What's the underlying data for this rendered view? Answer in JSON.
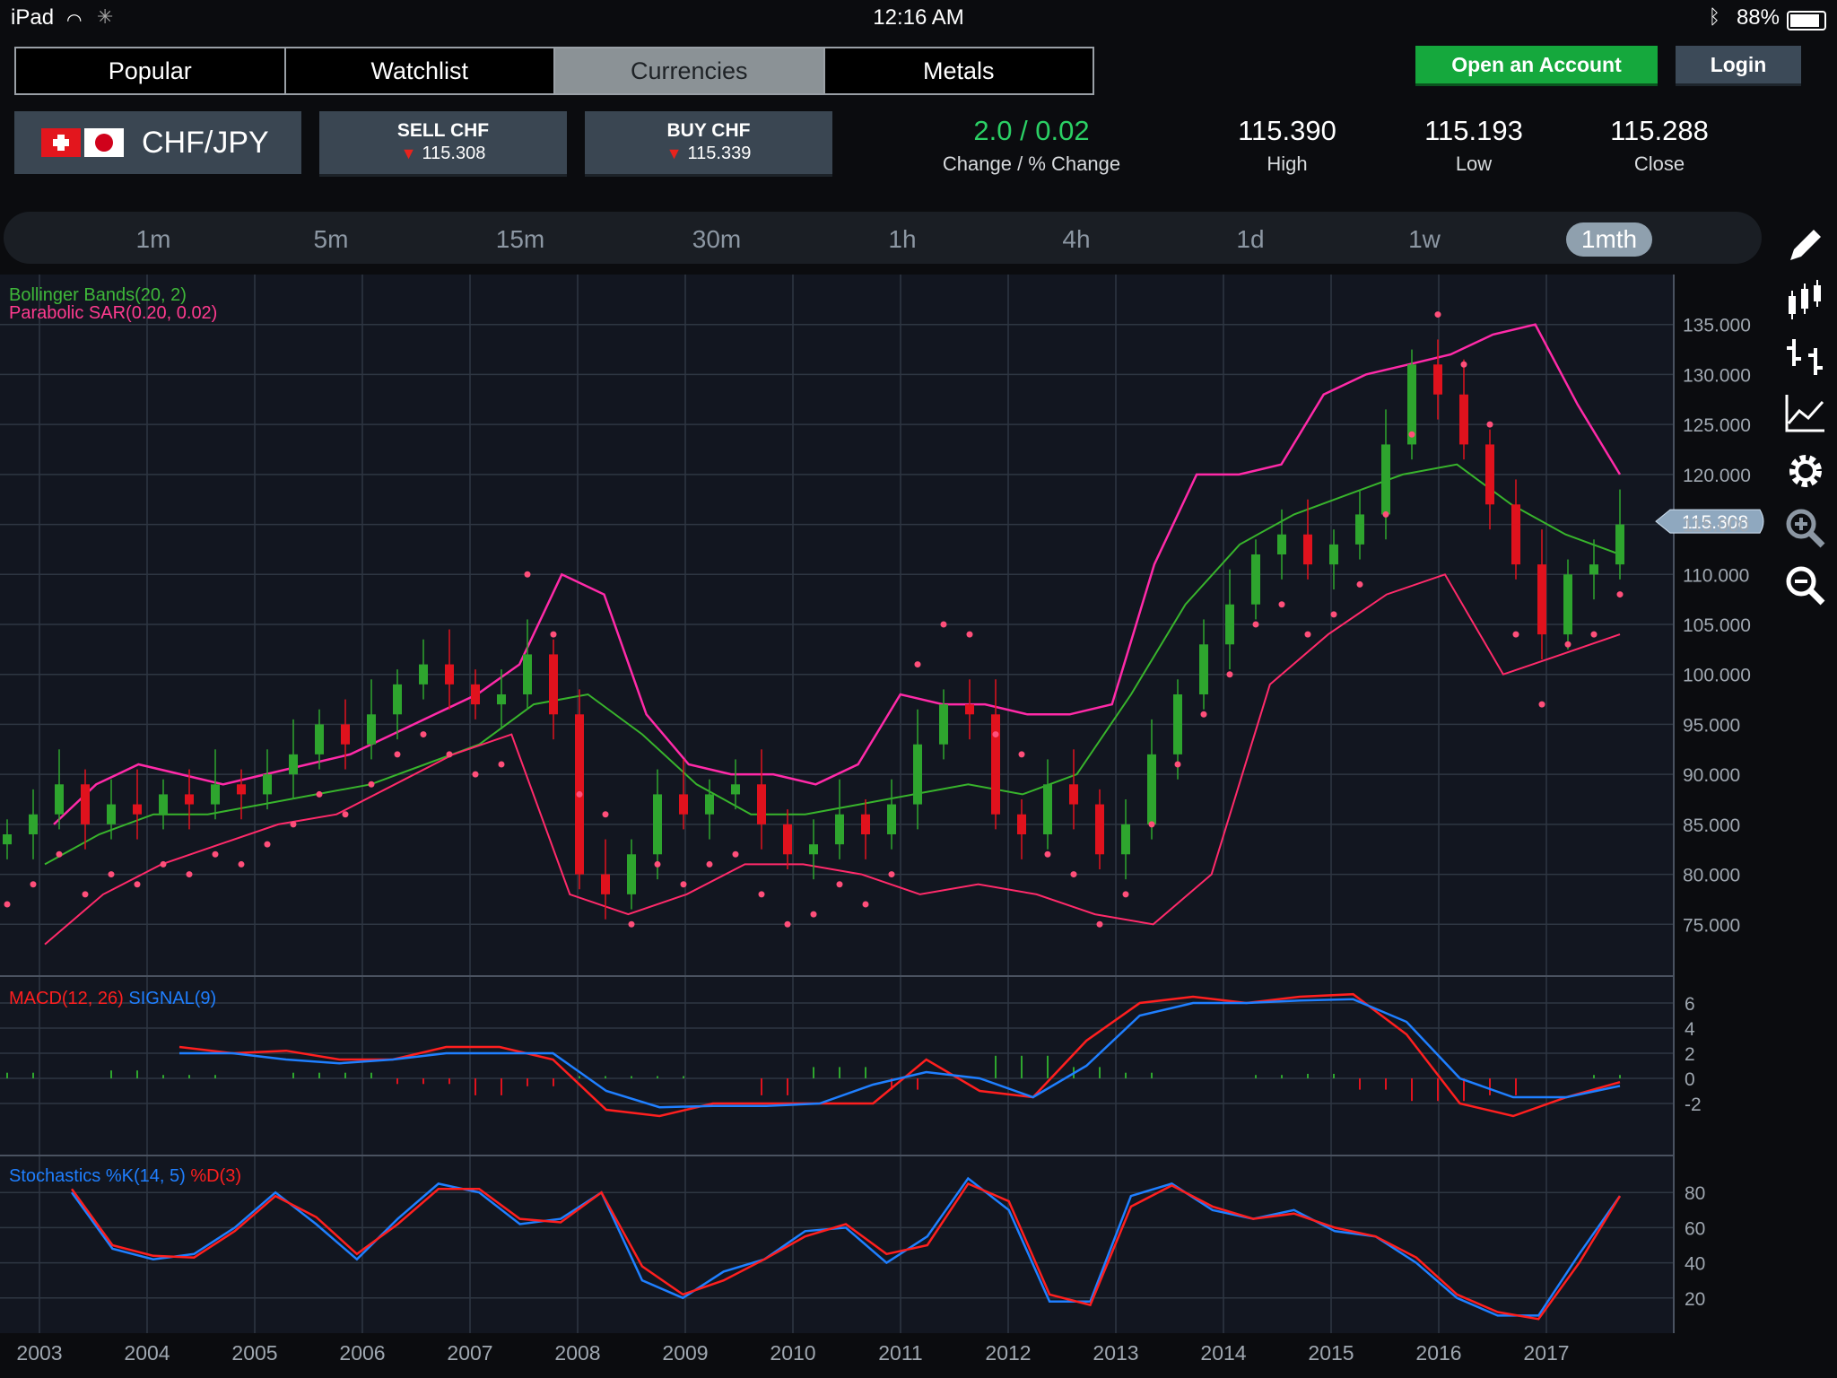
{
  "status_bar": {
    "device": "iPad",
    "time": "12:16 AM",
    "battery": "88%"
  },
  "top_tabs": [
    {
      "label": "Popular",
      "active": false
    },
    {
      "label": "Watchlist",
      "active": false
    },
    {
      "label": "Currencies",
      "active": true
    },
    {
      "label": "Metals",
      "active": false
    }
  ],
  "header_buttons": {
    "open_account": "Open an Account",
    "login": "Login"
  },
  "instrument": {
    "pair": "CHF/JPY",
    "sell": {
      "label": "SELL CHF",
      "price": "115.308"
    },
    "buy": {
      "label": "BUY CHF",
      "price": "115.339"
    },
    "change": {
      "value": "2.0 / 0.02",
      "label": "Change / % Change"
    },
    "high": {
      "value": "115.390",
      "label": "High"
    },
    "low": {
      "value": "115.193",
      "label": "Low"
    },
    "close": {
      "value": "115.288",
      "label": "Close"
    }
  },
  "timeframes": [
    "1m",
    "5m",
    "15m",
    "30m",
    "1h",
    "4h",
    "1d",
    "1w",
    "1mth"
  ],
  "active_timeframe": "1mth",
  "tools": [
    "pencil-icon",
    "candlestick-icon",
    "ohlc-bars-icon",
    "line-chart-icon",
    "settings-gear-icon",
    "zoom-in-icon",
    "zoom-out-icon"
  ],
  "colors": {
    "bull": "#2ea52e",
    "bear": "#e0121d",
    "upper_band": "#ff2aa8",
    "mid_band": "#38b42c",
    "lower_band": "#ff2a6a",
    "sar": "#ff4f7a",
    "macd": "#ff1f1f",
    "signal": "#1f7fff",
    "stoch_k": "#1f7fff",
    "stoch_d": "#ff1f1f"
  },
  "chart_data": {
    "type": "candlestick",
    "current_price_label": "115.308",
    "price_axis": {
      "ticks": [
        "135.000",
        "130.000",
        "125.000",
        "120.000",
        "115.000",
        "110.000",
        "105.000",
        "100.000",
        "95.000",
        "90.000",
        "85.000",
        "80.000",
        "75.000"
      ],
      "range": [
        70,
        140
      ]
    },
    "x_axis": {
      "ticks": [
        "2003",
        "2004",
        "2005",
        "2006",
        "2007",
        "2008",
        "2009",
        "2010",
        "2011",
        "2012",
        "2013",
        "2014",
        "2015",
        "2016",
        "2017"
      ]
    },
    "indicator_labels": {
      "bollinger": "Bollinger Bands(20, 2)",
      "sar": "Parabolic SAR(0.20, 0.02)"
    },
    "closes": [
      84,
      86,
      89,
      85,
      87,
      86,
      88,
      87,
      89,
      88,
      90,
      92,
      95,
      93,
      96,
      99,
      101,
      99,
      97,
      98,
      102,
      96,
      80,
      78,
      82,
      88,
      86,
      88,
      89,
      85,
      82,
      83,
      86,
      84,
      87,
      93,
      97,
      96,
      86,
      84,
      89,
      87,
      82,
      85,
      92,
      98,
      103,
      107,
      112,
      114,
      111,
      113,
      116,
      123,
      131,
      128,
      123,
      117,
      111,
      104,
      110,
      111,
      115
    ],
    "upper_band": [
      85,
      89,
      91,
      90,
      89,
      90,
      91,
      92,
      94,
      96,
      98,
      101,
      110,
      108,
      96,
      91,
      90,
      90,
      89,
      91,
      98,
      97,
      97,
      96,
      96,
      97,
      111,
      120,
      120,
      121,
      128,
      130,
      131,
      132,
      134,
      135,
      127,
      120
    ],
    "middle_band": [
      81,
      84,
      86,
      86,
      87,
      88,
      89,
      91,
      93,
      97,
      98,
      94,
      89,
      86,
      86,
      87,
      88,
      89,
      88,
      90,
      98,
      107,
      113,
      116,
      118,
      120,
      121,
      117,
      114,
      112
    ],
    "lower_band": [
      73,
      78,
      81,
      83,
      85,
      86,
      89,
      92,
      94,
      78,
      76,
      78,
      81,
      81,
      80,
      78,
      79,
      78,
      76,
      75,
      80,
      99,
      104,
      108,
      110,
      100,
      102,
      104
    ],
    "macd_axis": {
      "ticks": [
        "6",
        "4",
        "2",
        "0",
        "-2"
      ]
    },
    "macd_labels": {
      "macd": "MACD(12, 26)",
      "signal": "SIGNAL(9)"
    },
    "macd": [
      2.5,
      2.0,
      2.2,
      1.5,
      1.5,
      2.5,
      2.5,
      1.5,
      -2.5,
      -3.0,
      -2.0,
      -2.0,
      -2.0,
      -2.0,
      1.5,
      -1.0,
      -1.5,
      3.0,
      6.0,
      6.5,
      6.0,
      6.5,
      6.7,
      3.5,
      -2.0,
      -3.0,
      -1.5,
      -0.3
    ],
    "signal": [
      2.0,
      2.0,
      1.5,
      1.2,
      1.5,
      2.0,
      2.0,
      2.0,
      -1.0,
      -2.3,
      -2.2,
      -2.2,
      -2.0,
      -0.5,
      0.5,
      0.0,
      -1.5,
      1.0,
      5.0,
      6.0,
      6.0,
      6.2,
      6.3,
      4.5,
      0.0,
      -1.5,
      -1.5,
      -0.6
    ],
    "stoch_axis": {
      "ticks": [
        "80",
        "60",
        "40",
        "20"
      ]
    },
    "stoch_labels": {
      "k": "Stochastics %K(14, 5)",
      "d": "%D(3)"
    },
    "stoch_k": [
      80,
      48,
      42,
      45,
      60,
      80,
      62,
      42,
      65,
      85,
      80,
      62,
      65,
      80,
      30,
      20,
      35,
      42,
      58,
      60,
      40,
      55,
      88,
      70,
      18,
      18,
      78,
      85,
      70,
      65,
      70,
      58,
      55,
      40,
      20,
      10,
      10,
      45,
      78
    ],
    "stoch_d": [
      82,
      50,
      44,
      43,
      58,
      78,
      66,
      45,
      62,
      82,
      82,
      65,
      63,
      80,
      38,
      22,
      30,
      42,
      55,
      62,
      45,
      50,
      85,
      75,
      22,
      16,
      72,
      84,
      72,
      65,
      68,
      60,
      55,
      43,
      22,
      12,
      8,
      40,
      78
    ]
  }
}
